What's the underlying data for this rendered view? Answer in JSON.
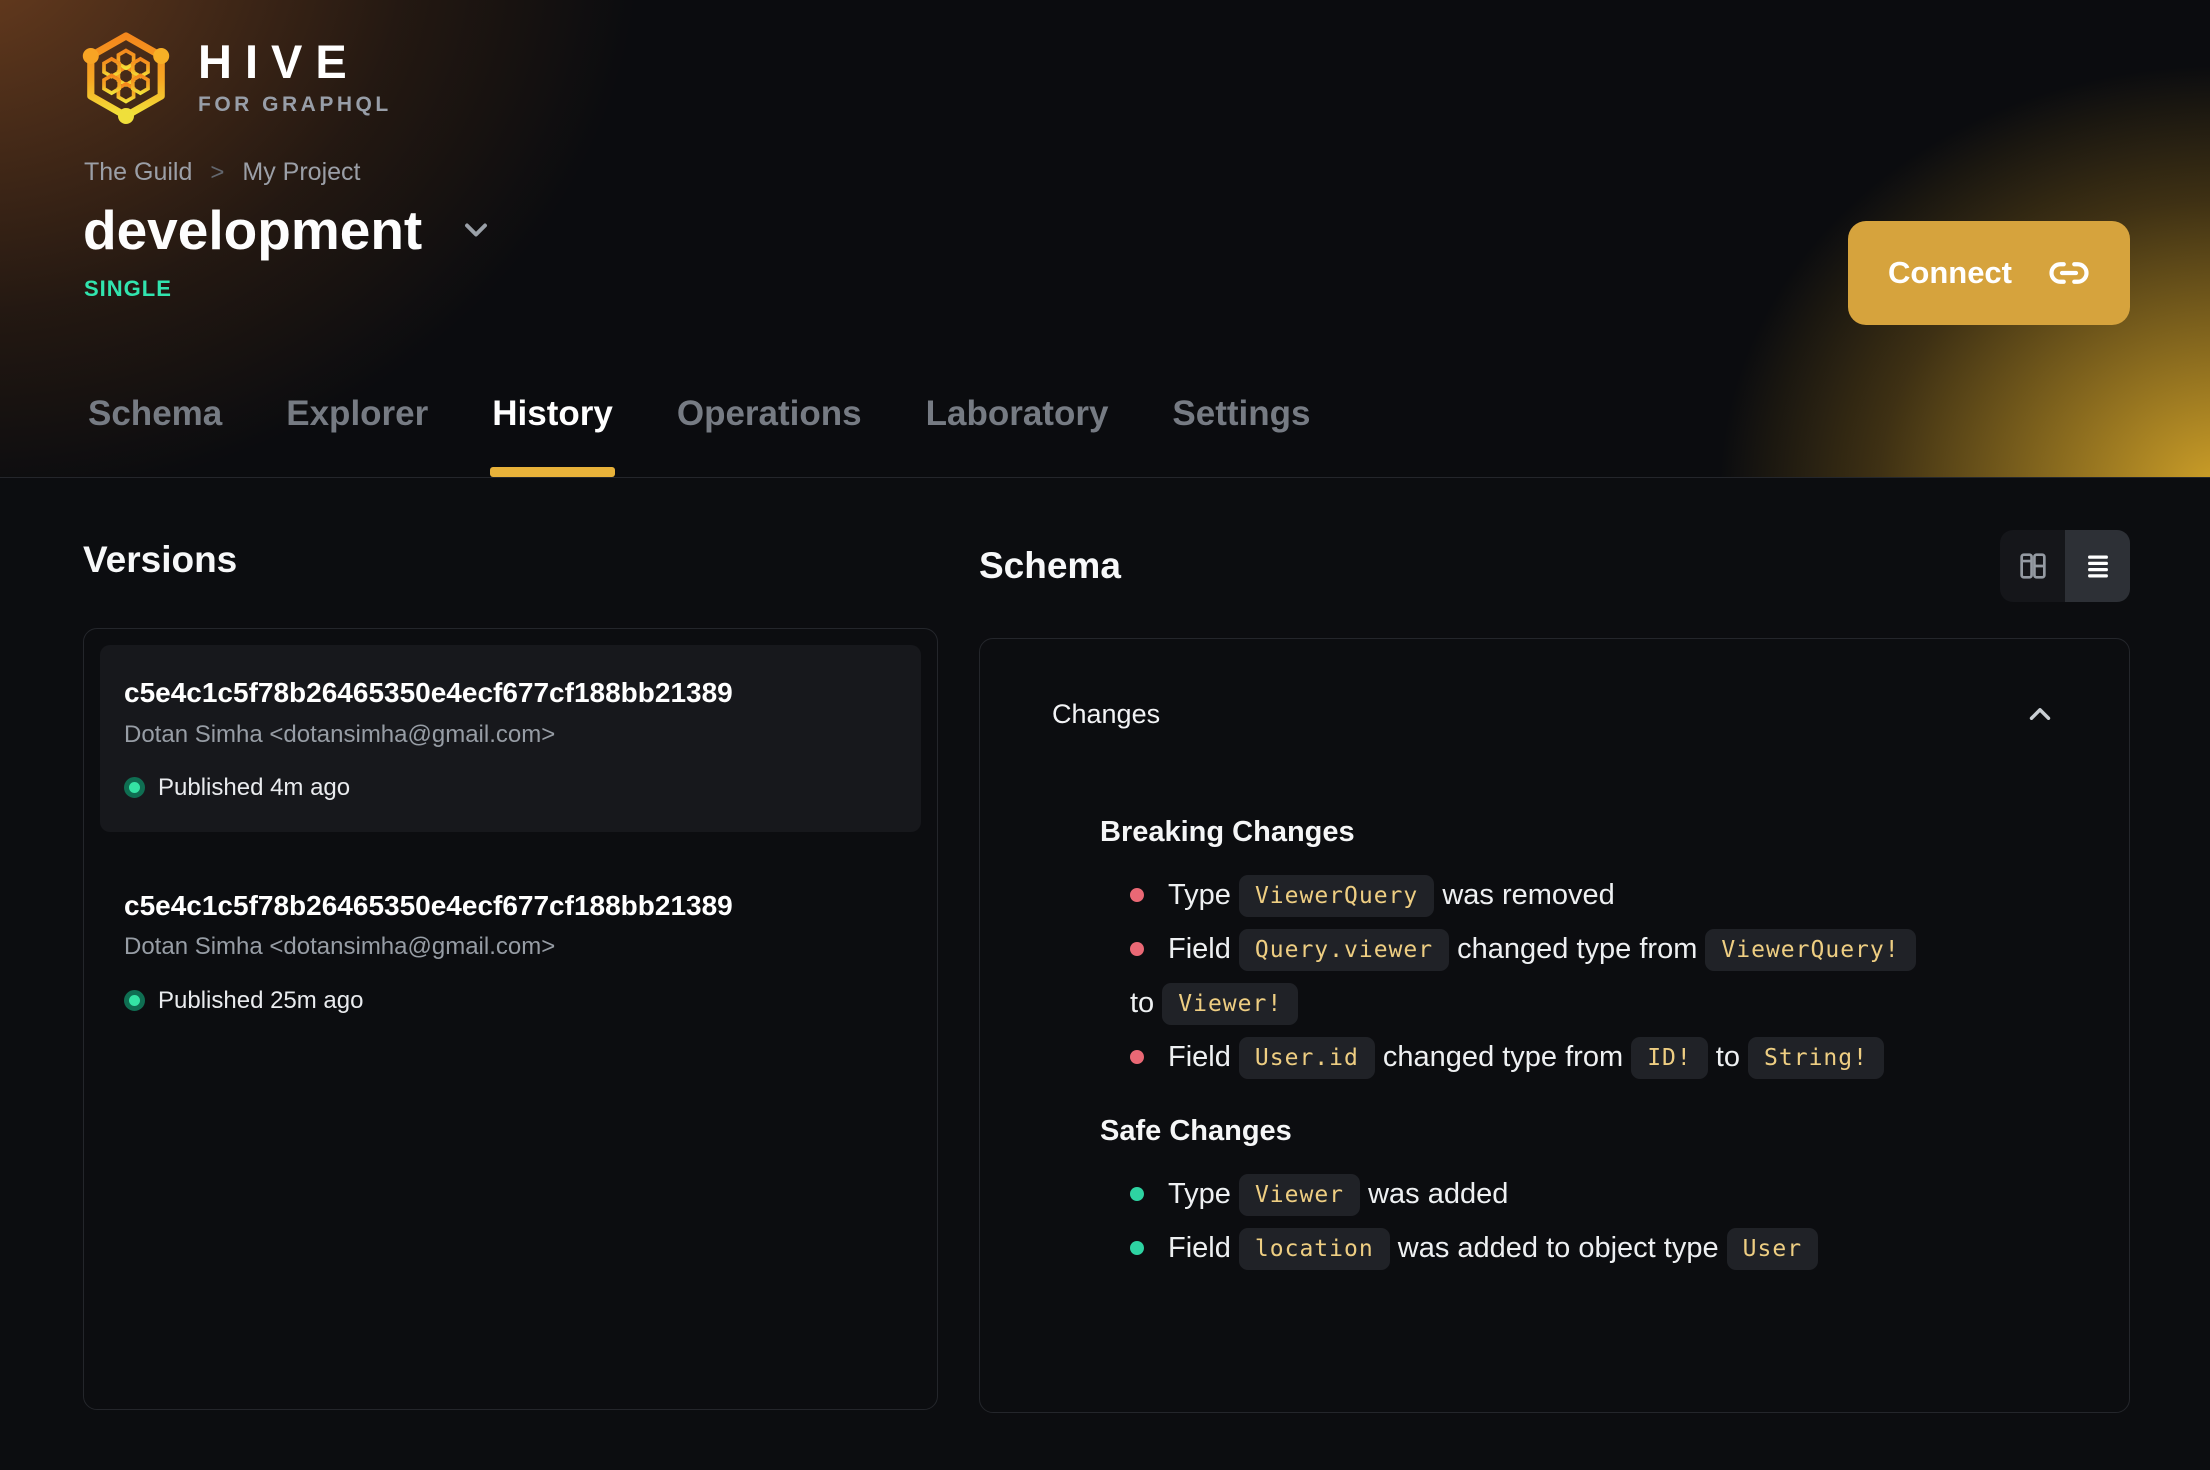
{
  "brand": {
    "name": "HIVE",
    "tagline": "FOR GRAPHQL"
  },
  "breadcrumb": {
    "items": [
      "The Guild",
      "My Project"
    ],
    "separator": ">"
  },
  "target": {
    "name": "development",
    "badge": "SINGLE"
  },
  "connect": {
    "label": "Connect"
  },
  "tabs": {
    "items": [
      {
        "label": "Schema",
        "active": false
      },
      {
        "label": "Explorer",
        "active": false
      },
      {
        "label": "History",
        "active": true
      },
      {
        "label": "Operations",
        "active": false
      },
      {
        "label": "Laboratory",
        "active": false
      },
      {
        "label": "Settings",
        "active": false
      }
    ]
  },
  "versions": {
    "title": "Versions",
    "items": [
      {
        "hash": "c5e4c1c5f78b26465350e4ecf677cf188bb21389",
        "author": "Dotan Simha <dotansimha@gmail.com>",
        "status": "Published 4m ago",
        "selected": true
      },
      {
        "hash": "c5e4c1c5f78b26465350e4ecf677cf188bb21389",
        "author": "Dotan Simha <dotansimha@gmail.com>",
        "status": "Published 25m ago",
        "selected": false
      }
    ]
  },
  "schema_panel": {
    "title": "Schema",
    "collapsible_title": "Changes",
    "sections": [
      {
        "title": "Breaking Changes",
        "kind": "breaking",
        "items": [
          {
            "segments": [
              {
                "t": "text",
                "v": "Type"
              },
              {
                "t": "code",
                "v": "ViewerQuery"
              },
              {
                "t": "text",
                "v": "was removed"
              }
            ]
          },
          {
            "segments": [
              {
                "t": "text",
                "v": "Field"
              },
              {
                "t": "code",
                "v": "Query.viewer"
              },
              {
                "t": "text",
                "v": "changed type from"
              },
              {
                "t": "code",
                "v": "ViewerQuery!"
              },
              {
                "t": "br"
              },
              {
                "t": "text",
                "v": "to"
              },
              {
                "t": "code",
                "v": "Viewer!"
              }
            ]
          },
          {
            "segments": [
              {
                "t": "text",
                "v": "Field"
              },
              {
                "t": "code",
                "v": "User.id"
              },
              {
                "t": "text",
                "v": "changed type from"
              },
              {
                "t": "code",
                "v": "ID!"
              },
              {
                "t": "text",
                "v": "to"
              },
              {
                "t": "code",
                "v": "String!"
              }
            ]
          }
        ]
      },
      {
        "title": "Safe Changes",
        "kind": "safe",
        "items": [
          {
            "segments": [
              {
                "t": "text",
                "v": "Type"
              },
              {
                "t": "code",
                "v": "Viewer"
              },
              {
                "t": "text",
                "v": "was added"
              }
            ]
          },
          {
            "segments": [
              {
                "t": "text",
                "v": "Field"
              },
              {
                "t": "code",
                "v": "location"
              },
              {
                "t": "text",
                "v": "was added to object type"
              },
              {
                "t": "code",
                "v": "User"
              }
            ]
          }
        ]
      }
    ]
  },
  "icons": {
    "connect": "link",
    "project_selector": "chevron-down",
    "breadcrumb_separator": "chevron-right",
    "changes_collapse": "chevron-up",
    "view_left": "columns-board",
    "view_right": "rows-list",
    "version_status": "green-dot"
  },
  "colors": {
    "accent_underline": "#e8b23a",
    "connect_button": "#d6a33d",
    "badge": "#31e4ae",
    "breaking_bullet": "#ea6875",
    "safe_bullet": "#2ed3a2",
    "chip_text": "#eece82",
    "status_dot": "#34e3a4"
  }
}
